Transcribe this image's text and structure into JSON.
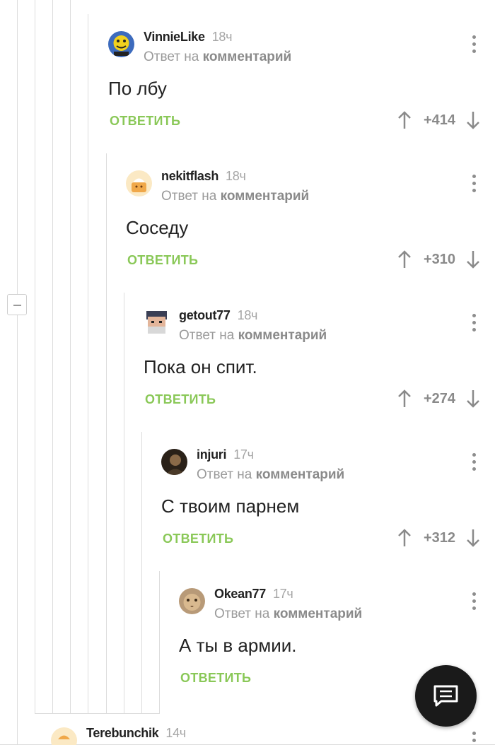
{
  "comments": [
    {
      "author": "VinnieLike",
      "time": "18ч",
      "reply_prefix": "Ответ на",
      "reply_target": "комментарий",
      "text": "По лбу",
      "reply_label": "ОТВЕТИТЬ",
      "rating": "+414"
    },
    {
      "author": "nekitflash",
      "time": "18ч",
      "reply_prefix": "Ответ на",
      "reply_target": "комментарий",
      "text": "Соседу",
      "reply_label": "ОТВЕТИТЬ",
      "rating": "+310"
    },
    {
      "author": "getout77",
      "time": "18ч",
      "reply_prefix": "Ответ на",
      "reply_target": "комментарий",
      "text": "Пока он спит.",
      "reply_label": "ОТВЕТИТЬ",
      "rating": "+274"
    },
    {
      "author": "injuri",
      "time": "17ч",
      "reply_prefix": "Ответ на",
      "reply_target": "комментарий",
      "text": "С твоим парнем",
      "reply_label": "ОТВЕТИТЬ",
      "rating": "+312"
    },
    {
      "author": "Okean77",
      "time": "17ч",
      "reply_prefix": "Ответ на",
      "reply_target": "комментарий",
      "text": "А ты в армии.",
      "reply_label": "ОТВЕТИТЬ",
      "rating": ""
    },
    {
      "author": "Terebunchik",
      "time": "14ч"
    }
  ],
  "colors": {
    "reply_green": "#8ac858",
    "muted_gray": "#9a9a9a",
    "fab_background": "#1a1a1a"
  },
  "icons": {
    "vote_up": "arrow-up-icon",
    "vote_down": "arrow-down-icon",
    "menu": "more-vertical-icon",
    "fab": "comment-icon",
    "collapse": "minus-icon"
  }
}
